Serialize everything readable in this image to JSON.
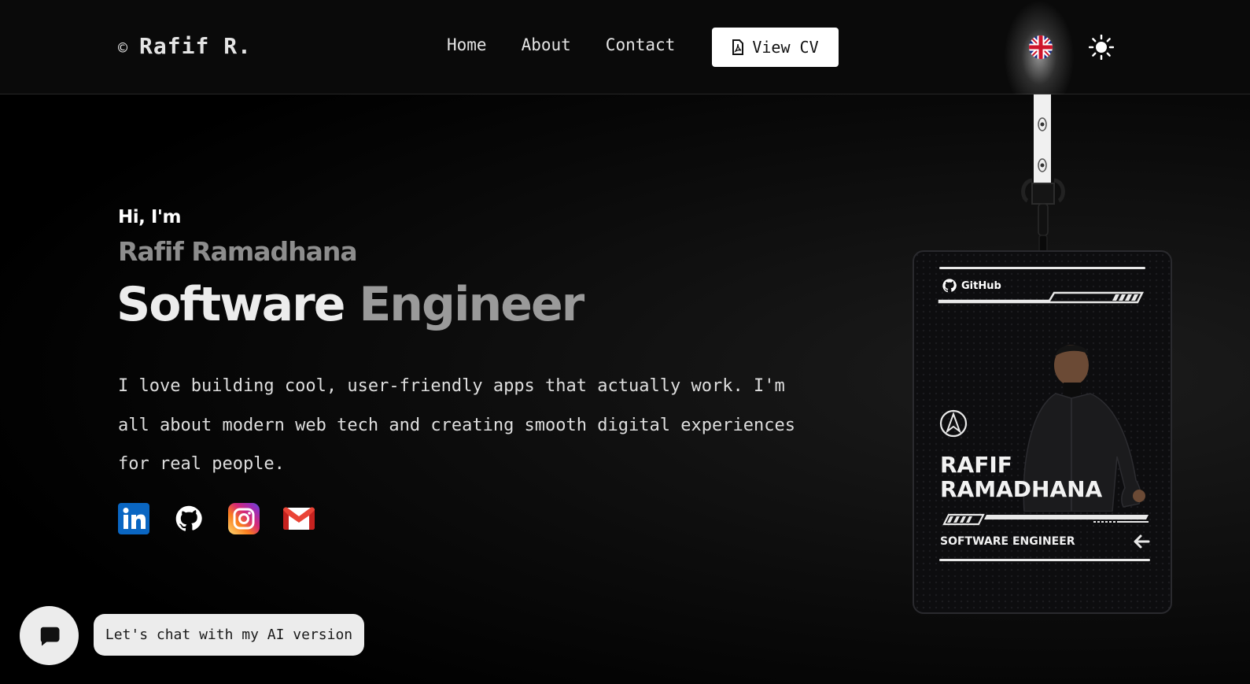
{
  "header": {
    "brand_symbol": "©",
    "brand_name": "Rafif R.",
    "nav": [
      "Home",
      "About",
      "Contact"
    ],
    "cv_label": "View CV",
    "language_flag": "uk-flag-icon",
    "theme_icon": "sun-icon"
  },
  "hero": {
    "greeting": "Hi, I'm",
    "name": "Rafif Ramadhana",
    "role_word1": "Software",
    "role_word2": "Engineer",
    "description": "I love building cool, user-friendly apps that actually work. I'm all about modern web tech and creating smooth digital experiences for real people.",
    "socials": [
      "linkedin-icon",
      "github-icon",
      "instagram-icon",
      "gmail-icon"
    ]
  },
  "card": {
    "badge": "GitHub",
    "name_line1": "RAFIF",
    "name_line2": "RAMADHANA",
    "role": "SOFTWARE ENGINEER"
  },
  "chat": {
    "label": "Let's chat with my AI version"
  },
  "colors": {
    "background": "#000000",
    "accent_button": "#ffffff",
    "muted_text": "#8d8d8d"
  }
}
